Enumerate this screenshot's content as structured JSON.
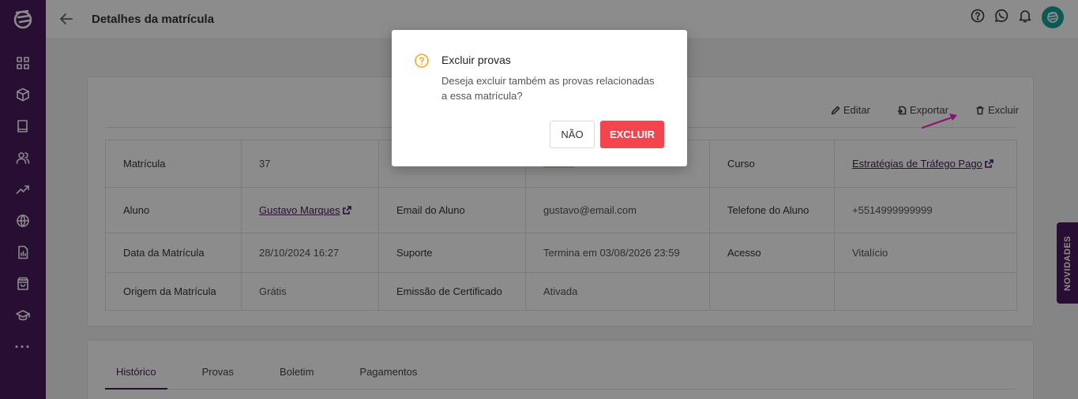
{
  "header": {
    "title": "Detalhes da matrícula"
  },
  "toolbar": {
    "edit_label": "Editar",
    "export_label": "Exportar",
    "delete_label": "Excluir"
  },
  "details": {
    "row1": {
      "l1": "Matrícula",
      "v1": "37",
      "l3": "Curso",
      "v3": "Estratégias de Tráfego Pago"
    },
    "row2": {
      "l1": "Aluno",
      "v1": "Gustavo Marques",
      "l2": "Email do Aluno",
      "v2": "gustavo@email.com",
      "l3": "Telefone do Aluno",
      "v3": "+5514999999999"
    },
    "row3": {
      "l1": "Data da Matrícula",
      "v1": "28/10/2024 16:27",
      "l2": "Suporte",
      "v2": "Termina em 03/08/2026 23:59",
      "l3": "Acesso",
      "v3": "Vitalício"
    },
    "row4": {
      "l1": "Origem da Matrícula",
      "v1": "Grátis",
      "l2": "Emissão de Certificado",
      "v2": "Ativada"
    }
  },
  "tabs": [
    "Histórico",
    "Provas",
    "Boletim",
    "Pagamentos"
  ],
  "novidades_label": "NOVIDADES",
  "modal": {
    "title": "Excluir provas",
    "message": "Deseja excluir também as provas relacionadas a essa matrícula?",
    "cancel_label": "NÃO",
    "confirm_label": "EXCLUIR"
  },
  "colors": {
    "brand": "#4a1a5e",
    "danger": "#f4454f",
    "warning": "#f5a623",
    "avatar": "#17a39a"
  },
  "icons": {
    "sidebar": [
      "dashboard-icon",
      "box-icon",
      "book-icon",
      "users-icon",
      "trending-icon",
      "globe-icon",
      "report-icon",
      "bag-icon",
      "graduation-icon",
      "more-icon"
    ],
    "header": [
      "help-icon",
      "whatsapp-icon",
      "bell-icon"
    ]
  }
}
